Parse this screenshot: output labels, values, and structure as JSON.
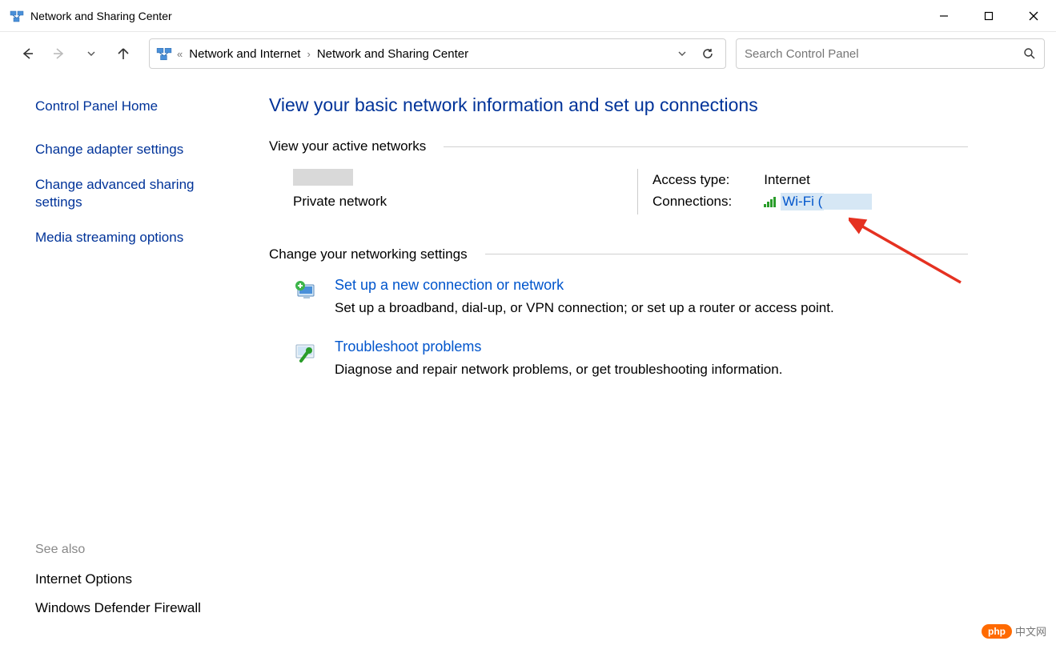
{
  "window": {
    "title": "Network and Sharing Center"
  },
  "breadcrumb": {
    "level1": "Network and Internet",
    "level2": "Network and Sharing Center"
  },
  "search": {
    "placeholder": "Search Control Panel"
  },
  "sidebar": {
    "home": "Control Panel Home",
    "links": [
      "Change adapter settings",
      "Change advanced sharing settings",
      "Media streaming options"
    ],
    "see_also_label": "See also",
    "see_also": [
      "Internet Options",
      "Windows Defender Firewall"
    ]
  },
  "main": {
    "heading": "View your basic network information and set up connections",
    "active_section": "View your active networks",
    "network": {
      "type_label": "Private network",
      "access_type_label": "Access type:",
      "access_type_value": "Internet",
      "connections_label": "Connections:",
      "connection_link": "Wi-Fi ("
    },
    "change_section": "Change your networking settings",
    "settings": [
      {
        "link": "Set up a new connection or network",
        "desc": "Set up a broadband, dial-up, or VPN connection; or set up a router or access point."
      },
      {
        "link": "Troubleshoot problems",
        "desc": "Diagnose and repair network problems, or get troubleshooting information."
      }
    ]
  },
  "watermark": {
    "badge": "php",
    "text": "中文网"
  }
}
